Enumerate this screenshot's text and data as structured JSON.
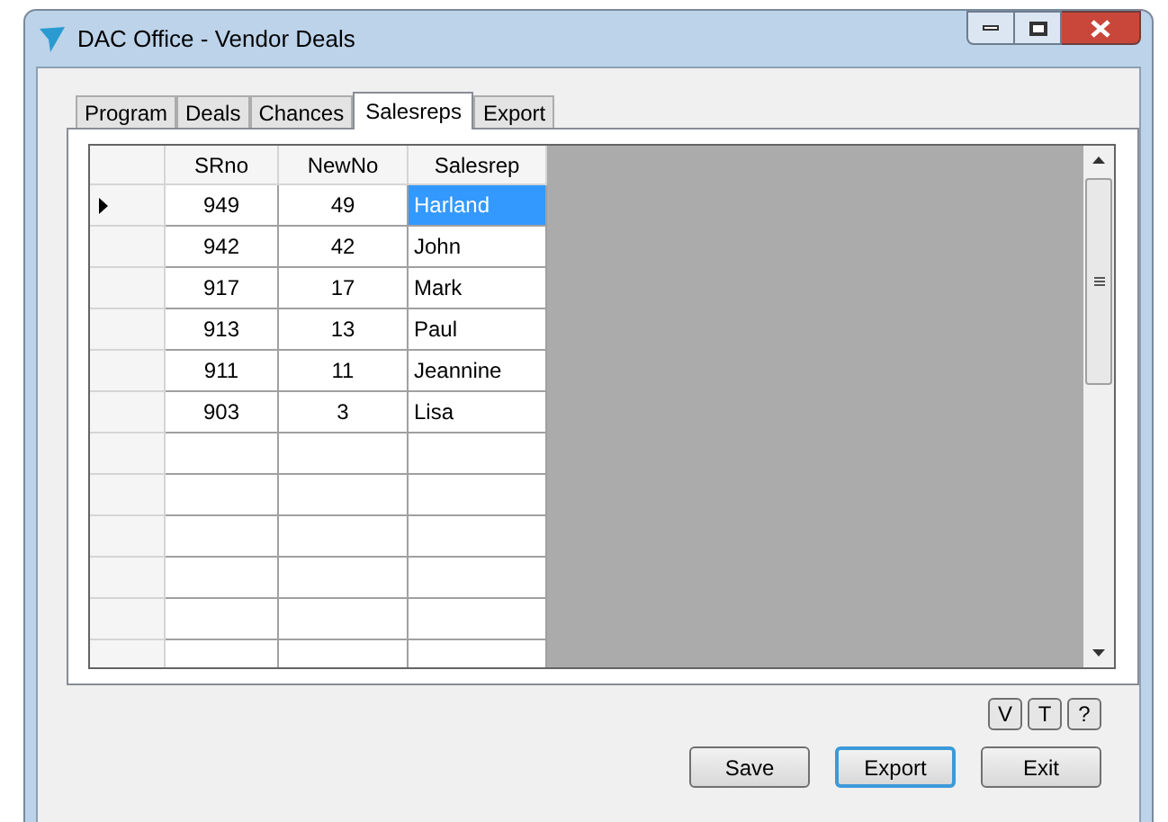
{
  "window": {
    "title": "DAC Office - Vendor Deals"
  },
  "tabs": [
    {
      "label": "Program",
      "selected": false
    },
    {
      "label": "Deals",
      "selected": false
    },
    {
      "label": "Chances",
      "selected": false
    },
    {
      "label": "Salesreps",
      "selected": true
    },
    {
      "label": "Export",
      "selected": false
    }
  ],
  "grid": {
    "columns": [
      "SRno",
      "NewNo",
      "Salesrep"
    ],
    "rows": [
      {
        "srno": "949",
        "newno": "49",
        "salesrep": "Harland",
        "selected": true
      },
      {
        "srno": "942",
        "newno": "42",
        "salesrep": "John",
        "selected": false
      },
      {
        "srno": "917",
        "newno": "17",
        "salesrep": "Mark",
        "selected": false
      },
      {
        "srno": "913",
        "newno": "13",
        "salesrep": "Paul",
        "selected": false
      },
      {
        "srno": "911",
        "newno": "11",
        "salesrep": "Jeannine",
        "selected": false
      },
      {
        "srno": "903",
        "newno": "3",
        "salesrep": "Lisa",
        "selected": false
      }
    ]
  },
  "small_buttons": [
    "V",
    "T",
    "?"
  ],
  "buttons": [
    {
      "label": "Save",
      "focused": false
    },
    {
      "label": "Export",
      "focused": true
    },
    {
      "label": "Exit",
      "focused": false
    }
  ]
}
